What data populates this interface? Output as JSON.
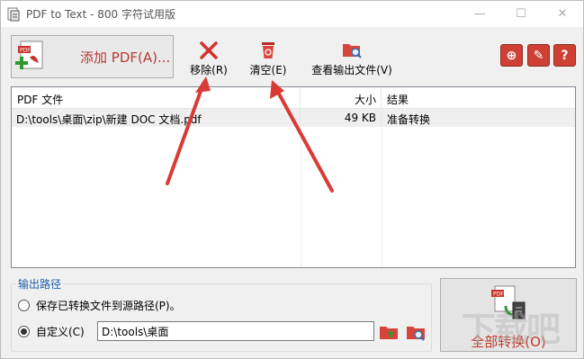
{
  "window": {
    "title": "PDF to Text - 800 字符试用版",
    "controls": {
      "minimize": "—",
      "maximize": "☐",
      "close": "✕"
    }
  },
  "toolbar": {
    "add_pdf_label": "添加 PDF(A)...",
    "remove_label": "移除(R)",
    "clear_label": "清空(E)",
    "view_output_label": "查看输出文件(V)",
    "round_buttons": [
      {
        "icon": "globe-icon",
        "glyph": "⊕"
      },
      {
        "icon": "key-icon",
        "glyph": "✎"
      },
      {
        "icon": "help-icon",
        "glyph": "?"
      }
    ]
  },
  "file_list": {
    "columns": [
      "PDF 文件",
      "大小",
      "结果"
    ],
    "rows": [
      {
        "file": "D:\\tools\\桌面\\zip\\新建 DOC 文档.pdf",
        "size": "49 KB",
        "result": "准备转换"
      }
    ]
  },
  "output": {
    "legend": "输出路径",
    "option_source_label": "保存已转换文件到源路径(P)。",
    "option_custom_label": "自定义(C)",
    "selected": "custom",
    "custom_path": "D:\\tools\\桌面"
  },
  "convert": {
    "label": "全部转换(O)"
  },
  "watermark": "下载吧",
  "colors": {
    "accent_red": "#c0392b",
    "legend_blue": "#1f5fa8",
    "round_btn": "#cf4034",
    "annotation_arrow": "#d93a35"
  }
}
